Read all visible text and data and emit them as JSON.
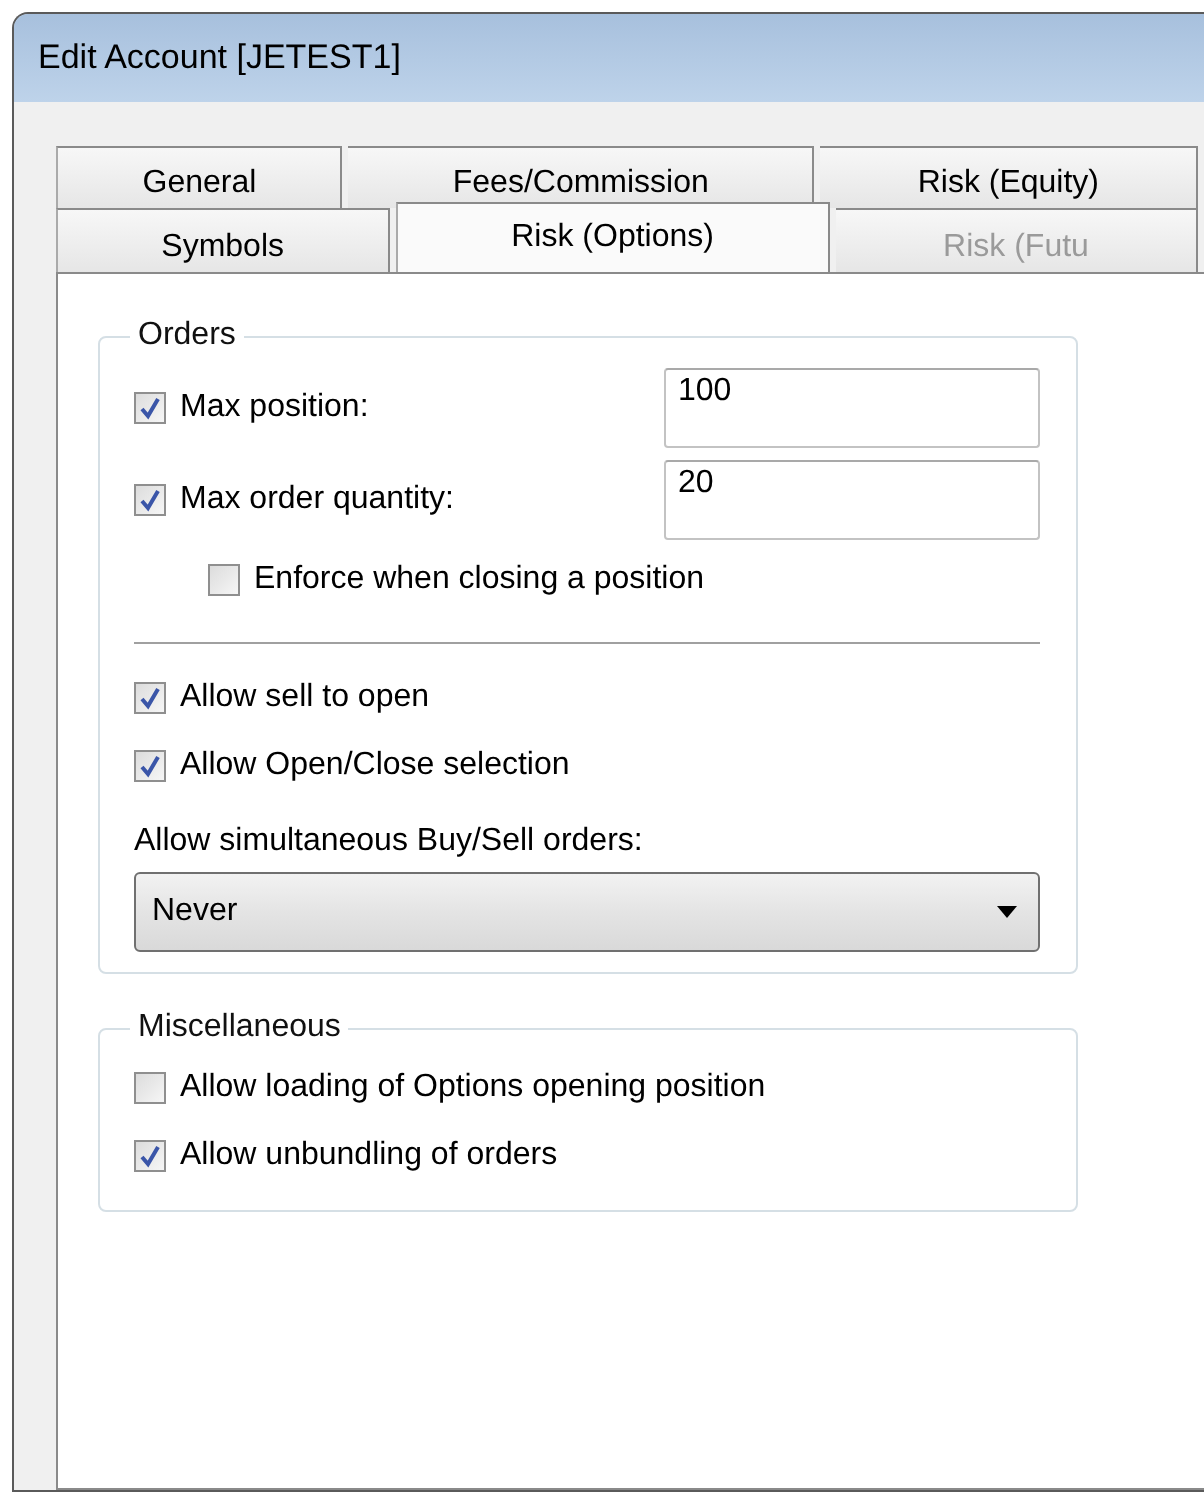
{
  "window": {
    "title": "Edit Account [JETEST1]"
  },
  "tab_rows": [
    [
      {
        "label": "General",
        "selected": false,
        "disabled": false
      },
      {
        "label": "Fees/Commission",
        "selected": false,
        "disabled": false
      },
      {
        "label": "Risk (Equity)",
        "selected": false,
        "disabled": false
      }
    ],
    [
      {
        "label": "Symbols",
        "selected": false,
        "disabled": false
      },
      {
        "label": "Risk (Options)",
        "selected": true,
        "disabled": false
      },
      {
        "label": "Risk (Futu",
        "selected": false,
        "disabled": true
      }
    ]
  ],
  "groups": [
    {
      "title": "Orders",
      "items": [
        {
          "kind": "checkbox-field",
          "label": "Max position:",
          "checked": true,
          "value": "100"
        },
        {
          "kind": "checkbox-field",
          "label": "Max order quantity:",
          "checked": true,
          "value": "20",
          "children": [
            {
              "kind": "checkbox",
              "label": "Enforce when closing a position",
              "checked": false
            }
          ]
        },
        {
          "kind": "separator"
        },
        {
          "kind": "checkbox",
          "label": "Allow sell to open",
          "checked": true
        },
        {
          "kind": "checkbox",
          "label": "Allow Open/Close selection",
          "checked": true
        },
        {
          "kind": "dropdown",
          "label": "Allow simultaneous Buy/Sell orders:",
          "value": "Never"
        }
      ]
    },
    {
      "title": "Miscellaneous",
      "items": [
        {
          "kind": "checkbox",
          "label": "Allow loading of Options opening position",
          "checked": false
        },
        {
          "kind": "checkbox",
          "label": "Allow unbundling of orders",
          "checked": true
        }
      ]
    }
  ]
}
